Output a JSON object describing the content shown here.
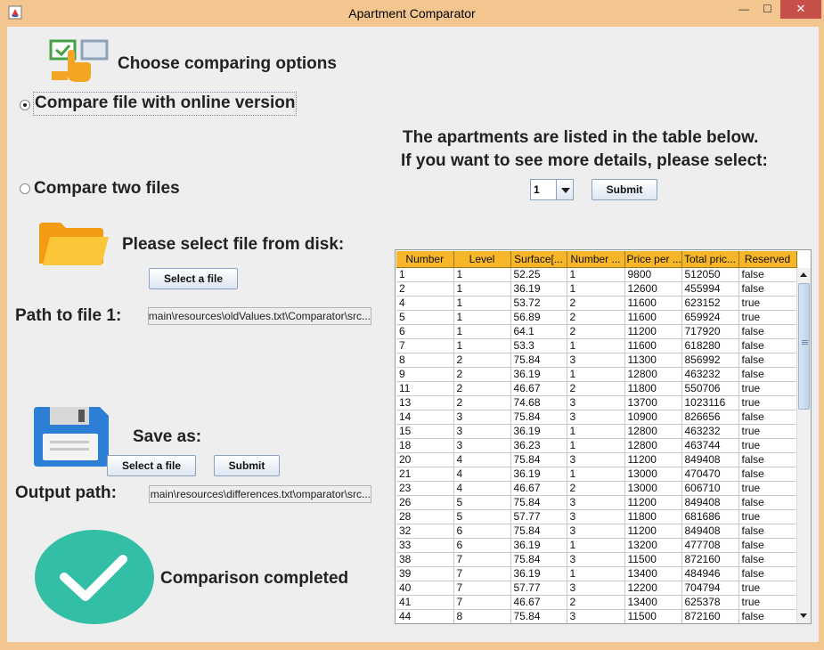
{
  "window": {
    "title": "Apartment Comparator",
    "minimize": "—",
    "maximize": "☐",
    "close": "✕"
  },
  "left": {
    "heading": "Choose comparing options",
    "option_online": "Compare file with online version",
    "option_two_files": "Compare two files",
    "select_prompt": "Please select file from disk:",
    "select_file_button": "Select a file",
    "path1_label": "Path to file 1:",
    "path1_value": "...main\\resources\\oldValues.txt\\Comparator\\src",
    "save_as_label": "Save as:",
    "save_select_button": "Select a file",
    "save_submit_button": "Submit",
    "output_label": "Output path:",
    "output_value": "...main\\resources\\differences.txt\\omparator\\src",
    "status": "Comparison completed",
    "status_color": "#33bfa6"
  },
  "right": {
    "instruction_line1": "The apartments are listed in the table below.",
    "instruction_line2": "If you want to see more details, please select:",
    "select_value": "1",
    "submit_button": "Submit",
    "columns": [
      "Number",
      "Level",
      "Surface[...",
      "Number ...",
      "Price per ...",
      "Total pric...",
      "Reserved"
    ],
    "rows": [
      [
        "1",
        "1",
        "52.25",
        "1",
        "9800",
        "512050",
        "false"
      ],
      [
        "2",
        "1",
        "36.19",
        "1",
        "12600",
        "455994",
        "false"
      ],
      [
        "4",
        "1",
        "53.72",
        "2",
        "11600",
        "623152",
        "true"
      ],
      [
        "5",
        "1",
        "56.89",
        "2",
        "11600",
        "659924",
        "true"
      ],
      [
        "6",
        "1",
        "64.1",
        "2",
        "11200",
        "717920",
        "false"
      ],
      [
        "7",
        "1",
        "53.3",
        "1",
        "11600",
        "618280",
        "false"
      ],
      [
        "8",
        "2",
        "75.84",
        "3",
        "11300",
        "856992",
        "false"
      ],
      [
        "9",
        "2",
        "36.19",
        "1",
        "12800",
        "463232",
        "false"
      ],
      [
        "11",
        "2",
        "46.67",
        "2",
        "11800",
        "550706",
        "true"
      ],
      [
        "13",
        "2",
        "74.68",
        "3",
        "13700",
        "1023116",
        "true"
      ],
      [
        "14",
        "3",
        "75.84",
        "3",
        "10900",
        "826656",
        "false"
      ],
      [
        "15",
        "3",
        "36.19",
        "1",
        "12800",
        "463232",
        "true"
      ],
      [
        "18",
        "3",
        "36.23",
        "1",
        "12800",
        "463744",
        "true"
      ],
      [
        "20",
        "4",
        "75.84",
        "3",
        "11200",
        "849408",
        "false"
      ],
      [
        "21",
        "4",
        "36.19",
        "1",
        "13000",
        "470470",
        "false"
      ],
      [
        "23",
        "4",
        "46.67",
        "2",
        "13000",
        "606710",
        "true"
      ],
      [
        "26",
        "5",
        "75.84",
        "3",
        "11200",
        "849408",
        "false"
      ],
      [
        "28",
        "5",
        "57.77",
        "3",
        "11800",
        "681686",
        "true"
      ],
      [
        "32",
        "6",
        "75.84",
        "3",
        "11200",
        "849408",
        "false"
      ],
      [
        "33",
        "6",
        "36.19",
        "1",
        "13200",
        "477708",
        "false"
      ],
      [
        "38",
        "7",
        "75.84",
        "3",
        "11500",
        "872160",
        "false"
      ],
      [
        "39",
        "7",
        "36.19",
        "1",
        "13400",
        "484946",
        "false"
      ],
      [
        "40",
        "7",
        "57.77",
        "3",
        "12200",
        "704794",
        "true"
      ],
      [
        "41",
        "7",
        "46.67",
        "2",
        "13400",
        "625378",
        "true"
      ],
      [
        "44",
        "8",
        "75.84",
        "3",
        "11500",
        "872160",
        "false"
      ]
    ],
    "header_color": "#f6b628"
  }
}
